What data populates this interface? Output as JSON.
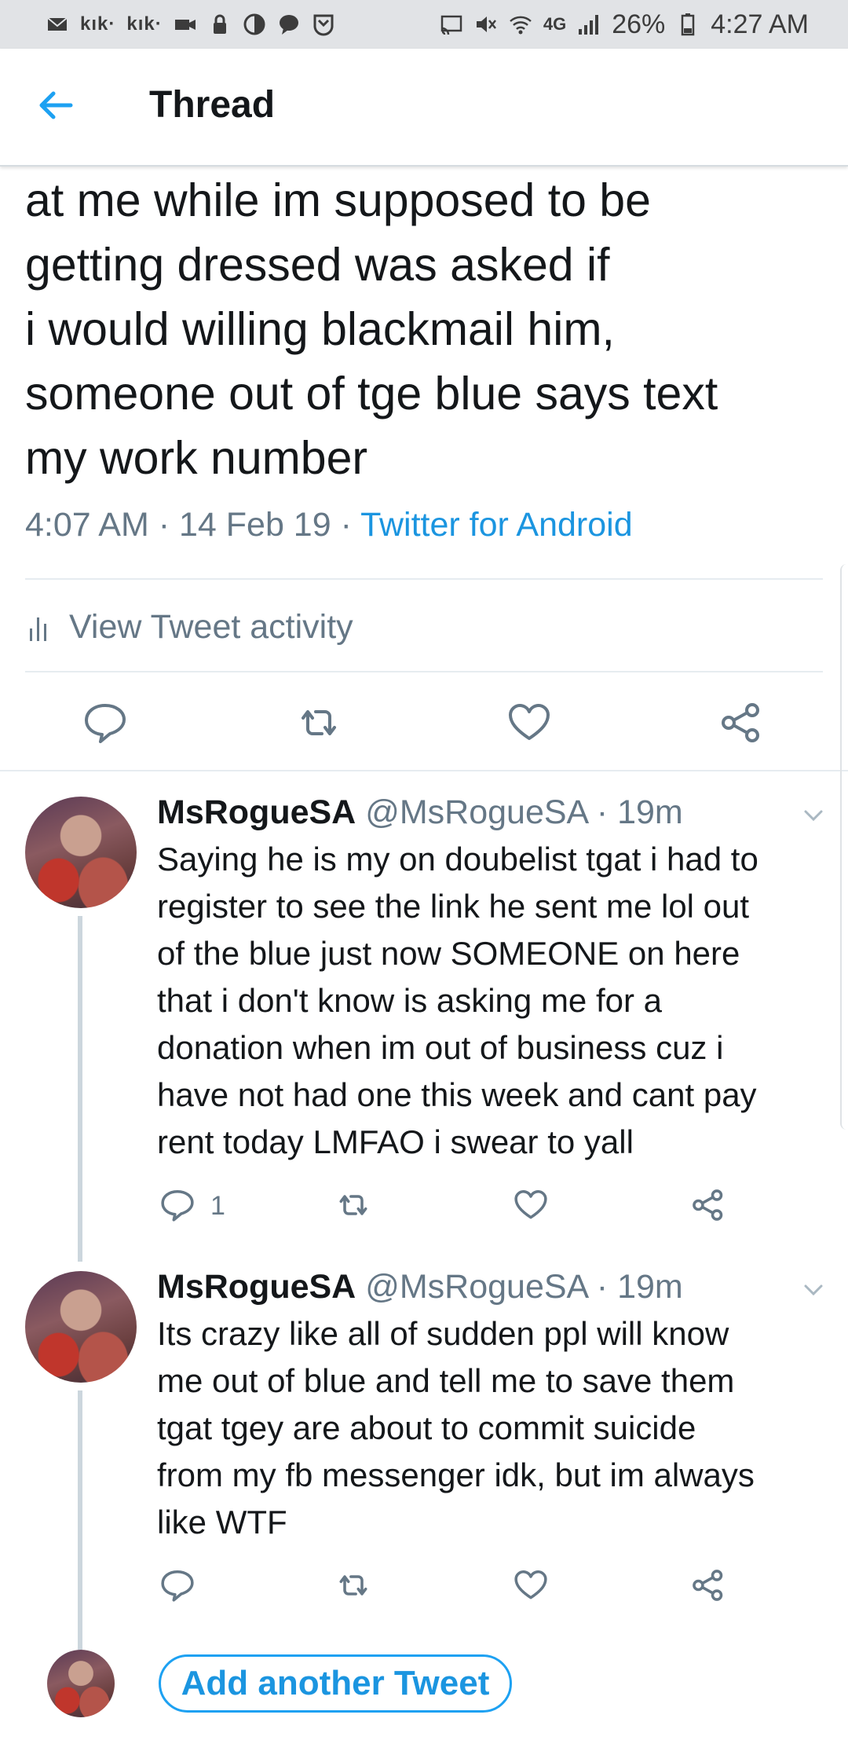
{
  "status_bar": {
    "notif_left_1": "kık·",
    "notif_left_2": "kık·",
    "network": "4G",
    "battery": "26%",
    "time": "4:27 AM"
  },
  "header": {
    "title": "Thread",
    "back_icon": "arrow-left-icon"
  },
  "main_tweet": {
    "text_lines": [
      "at me while im supposed to be",
      "getting dressed was asked if",
      "i would willing blackmail him,",
      "someone out of tge blue says text",
      "my work number"
    ],
    "time": "4:07 AM",
    "date": "14 Feb 19",
    "separator": " · ",
    "source": "Twitter for Android",
    "activity_label": "View Tweet activity"
  },
  "replies": [
    {
      "name": "MsRogueSA",
      "handle": "@MsRogueSA",
      "time": " · 19m",
      "text_lines": [
        "Saying he is my on doubelist tgat i had to",
        "register to see the link he sent me lol out",
        "of the blue just now SOMEONE on here",
        "that i don't know is asking me for a",
        "donation when im out of business cuz i",
        "have not had one this week and cant pay",
        "rent today LMFAO i swear to yall"
      ],
      "reply_count": "1"
    },
    {
      "name": "MsRogueSA",
      "handle": "@MsRogueSA",
      "time": " · 19m",
      "text_lines": [
        "Its crazy like all of sudden ppl will know",
        "me out of blue and tell me to save them",
        "tgat tgey are about to commit suicide",
        "from my fb messenger idk, but im always",
        "like WTF"
      ],
      "reply_count": ""
    }
  ],
  "compose": {
    "button_label": "Add another Tweet"
  },
  "colors": {
    "accent": "#1da1f2",
    "link": "#1b95e0",
    "secondary_text": "#657786",
    "divider": "#e6ecf0",
    "status_bar": "#e1e3e6"
  }
}
